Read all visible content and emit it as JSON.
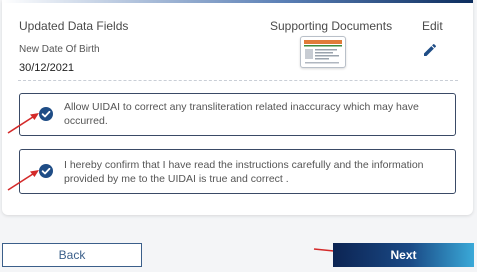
{
  "headers": {
    "updated_fields": "Updated Data Fields",
    "supporting_documents": "Supporting Documents",
    "edit": "Edit"
  },
  "field": {
    "label": "New Date Of Birth",
    "value": "30/12/2021"
  },
  "consents": [
    {
      "text": "Allow UIDAI to correct any transliteration related inaccuracy which may have occurred.",
      "checked": true
    },
    {
      "text": "I hereby confirm that I have read the instructions carefully and the information provided by me to the UIDAI is true and correct .",
      "checked": true
    }
  ],
  "buttons": {
    "back": "Back",
    "next": "Next"
  },
  "icons": {
    "edit": "pencil-icon",
    "checkbox": "check-circle-icon",
    "document": "document-thumbnail-icon",
    "annotation": "red-arrow-icon"
  },
  "colors": {
    "accent": "#1f4d86",
    "next_gradient_start": "#0c2453",
    "next_gradient_end": "#3aa9d8",
    "annotation_arrow": "#d42a2a"
  }
}
